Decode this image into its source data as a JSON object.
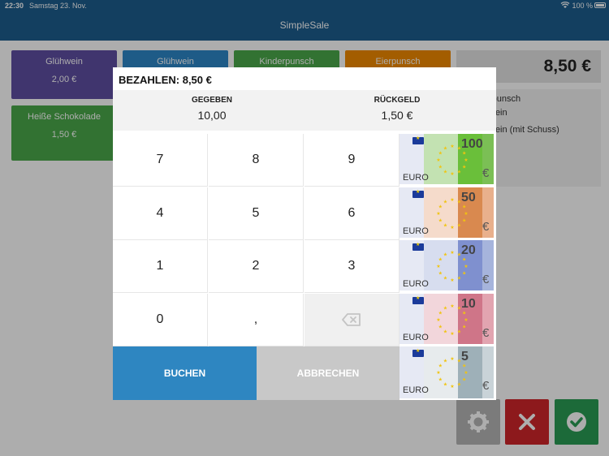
{
  "status": {
    "time": "22:30",
    "date": "Samstag 23. Nov.",
    "battery": "100 %"
  },
  "app": {
    "title": "SimpleSale"
  },
  "products": [
    {
      "name": "Glühwein",
      "price": "2,00 €",
      "color": "#5f4ea3"
    },
    {
      "name": "Glühwein",
      "price": "",
      "color": "#2d86c8"
    },
    {
      "name": "Kinderpunsch",
      "price": "",
      "color": "#4aa94a"
    },
    {
      "name": "Eierpunsch",
      "price": "",
      "color": "#f08a00"
    },
    {
      "name": "Heiße Schokolade",
      "price": "1,50 €",
      "color": "#4aa94a"
    }
  ],
  "order": {
    "total": "8,50 €",
    "items": [
      "rpunsch",
      "wein",
      "wein (mit Schuss)"
    ]
  },
  "payment": {
    "title": "BEZAHLEN: 8,50 €",
    "given_label": "GEGEBEN",
    "given_value": "10,00",
    "change_label": "RÜCKGELD",
    "change_value": "1,50 €",
    "keys": [
      "7",
      "8",
      "9",
      "4",
      "5",
      "6",
      "1",
      "2",
      "3",
      "0",
      ","
    ],
    "book_label": "BUCHEN",
    "cancel_label": "ABBRECHEN"
  },
  "notes": [
    {
      "value": "100",
      "euro_label": "EURO",
      "symbol": "€",
      "color": "#7bbf55",
      "strip_color": "#6abf3a"
    },
    {
      "value": "50",
      "euro_label": "EURO",
      "symbol": "€",
      "color": "#e9b08c",
      "strip_color": "#d9894f"
    },
    {
      "value": "20",
      "euro_label": "EURO",
      "symbol": "€",
      "color": "#a6b4dc",
      "strip_color": "#7f90cf"
    },
    {
      "value": "10",
      "euro_label": "EURO",
      "symbol": "€",
      "color": "#e2a4b0",
      "strip_color": "#cf7588"
    },
    {
      "value": "5",
      "euro_label": "EURO",
      "symbol": "€",
      "color": "#c9d3d8",
      "strip_color": "#9eb0b8"
    }
  ],
  "colors": {
    "primary": "#1c5d8e",
    "book": "#2e86c1",
    "cancel": "#c8c8c8",
    "delete_btn": "#d0252a",
    "confirm_btn": "#2a9d55",
    "settings_btn": "#b5b5b5"
  }
}
